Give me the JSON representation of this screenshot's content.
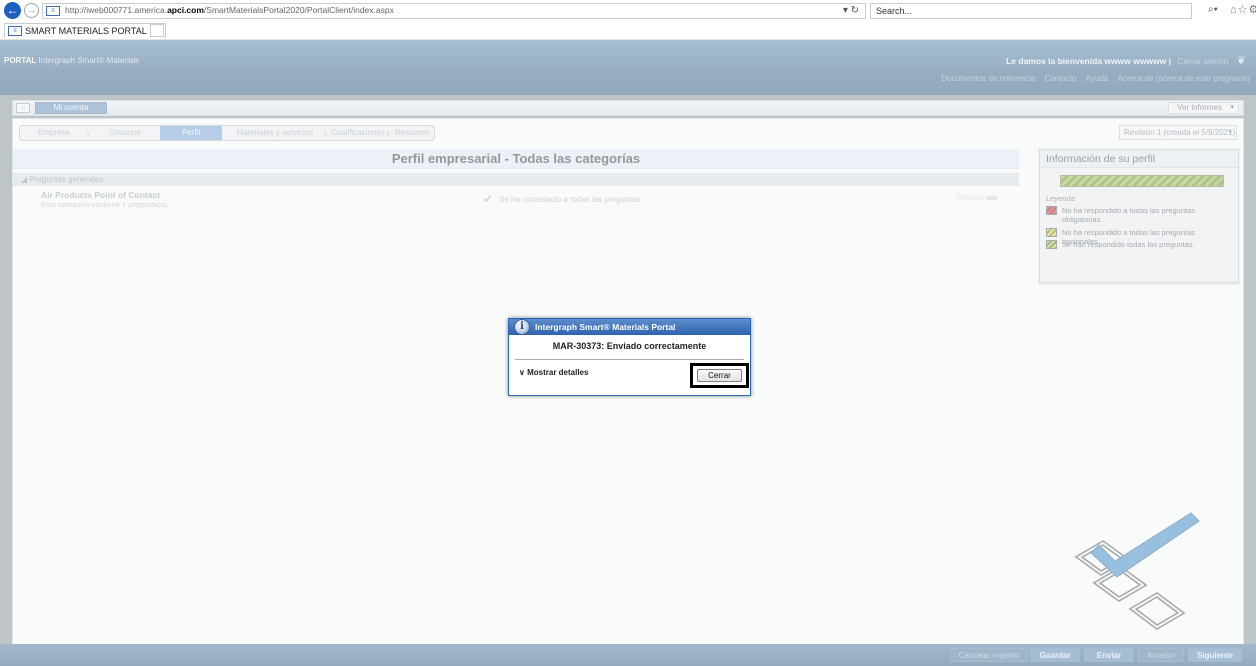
{
  "browser": {
    "url_prefix": "http://iweb000771.america.",
    "url_domain": "apci.com",
    "url_path": "/SmartMaterialsPortal2020/PortalClient/index.aspx",
    "search_placeholder": "Search...",
    "tab_title": "SMART MATERIALS PORTAL",
    "tab_close": "×"
  },
  "header": {
    "brand_prefix": "PORTAL",
    "brand_name": "Intergraph Smart® Materials",
    "welcome": "Le damos la bienvenida wwww wwwww",
    "separator": "|",
    "logout": "Cerrar sesión",
    "nav": [
      "Documentos de referencia",
      "Contacto",
      "Ayuda",
      "Acerca de (acerca de este programa)"
    ]
  },
  "toolbar": {
    "mi_cuenta": "Mi cuenta",
    "ver_informes": "Ver informes"
  },
  "steps": [
    "Empresa",
    "Usuarios",
    "Perfil",
    "Materiales y servicios",
    "Cualificaciones",
    "Resumen"
  ],
  "revision": "Revisión 1 (creada el 5/9/2021)",
  "main": {
    "title": "Perfil empresarial - Todas las categorías",
    "section": "Preguntas generales",
    "category_name": "Air Products Point of Contact",
    "category_desc": "Esta categoría contiene 1 pregunta(s).",
    "category_status": "Se ha contestado a todas las preguntas.",
    "revisar": "Revisar"
  },
  "profile": {
    "title": "Información de su perfil",
    "progress": 1.0,
    "legend_title": "Leyenda",
    "legend": [
      {
        "color": "red",
        "text": "No ha respondido a todas las preguntas obligatorias."
      },
      {
        "color": "yellow",
        "text": "No ha respondido a todas las preguntas opcionales."
      },
      {
        "color": "green",
        "text": "Se han respondido todas las preguntas."
      }
    ]
  },
  "footer": {
    "buttons": [
      "Cancelar registro",
      "Guardar",
      "Enviar",
      "Anterior",
      "Siguiente"
    ]
  },
  "dialog": {
    "title": "Intergraph Smart® Materials Portal",
    "message": "MAR-30373: Enviado correctamente",
    "details": "Mostrar detalles",
    "close": "Cerrar"
  },
  "colors": {
    "header_blue": "#2c5a84",
    "accent_blue": "#6a9bd0",
    "progress_green": "#8fb53a"
  }
}
